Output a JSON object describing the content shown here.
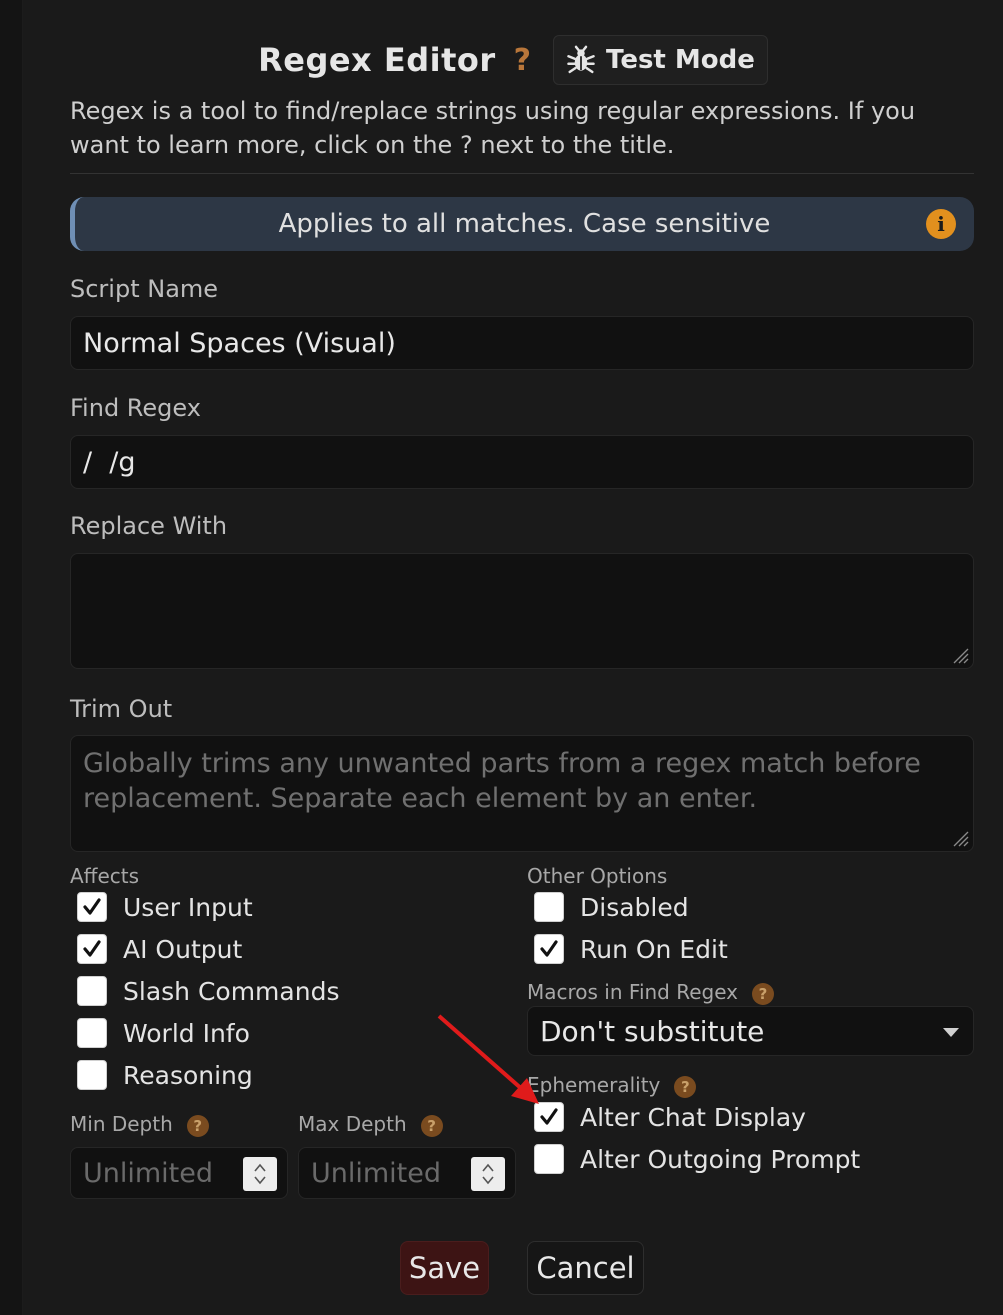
{
  "header": {
    "title": "Regex Editor",
    "help_icon": "?",
    "test_mode_label": "Test Mode",
    "test_mode_icon": "bug-icon"
  },
  "description": "Regex is a tool to find/replace strings using regular expressions. If you want to learn more, click on the ? next to the title.",
  "info_bar": {
    "text": "Applies to all matches. Case sensitive",
    "icon": "i"
  },
  "fields": {
    "script_name": {
      "label": "Script Name",
      "value": "Normal Spaces (Visual)"
    },
    "find_regex": {
      "label": "Find Regex",
      "value": "/  /g"
    },
    "replace_with": {
      "label": "Replace With",
      "value": ""
    },
    "trim_out": {
      "label": "Trim Out",
      "placeholder": "Globally trims any unwanted parts from a regex match before replacement. Separate each element by an enter."
    }
  },
  "affects": {
    "label": "Affects",
    "items": [
      {
        "label": "User Input",
        "checked": true
      },
      {
        "label": "AI Output",
        "checked": true
      },
      {
        "label": "Slash Commands",
        "checked": false
      },
      {
        "label": "World Info",
        "checked": false
      },
      {
        "label": "Reasoning",
        "checked": false
      }
    ]
  },
  "other_options": {
    "label": "Other Options",
    "items": [
      {
        "label": "Disabled",
        "checked": false
      },
      {
        "label": "Run On Edit",
        "checked": true
      }
    ]
  },
  "macros": {
    "label": "Macros in Find Regex",
    "help": "?",
    "selected": "Don't substitute"
  },
  "ephemerality": {
    "label": "Ephemerality",
    "help": "?",
    "items": [
      {
        "label": "Alter Chat Display",
        "checked": true
      },
      {
        "label": "Alter Outgoing Prompt",
        "checked": false
      }
    ]
  },
  "depth": {
    "min_label": "Min Depth",
    "max_label": "Max Depth",
    "help": "?",
    "min_placeholder": "Unlimited",
    "max_placeholder": "Unlimited"
  },
  "buttons": {
    "save": "Save",
    "cancel": "Cancel"
  },
  "colors": {
    "accent_orange": "#e2901e",
    "annotation_arrow": "#e01b1b",
    "save_bg": "#3d1414"
  }
}
